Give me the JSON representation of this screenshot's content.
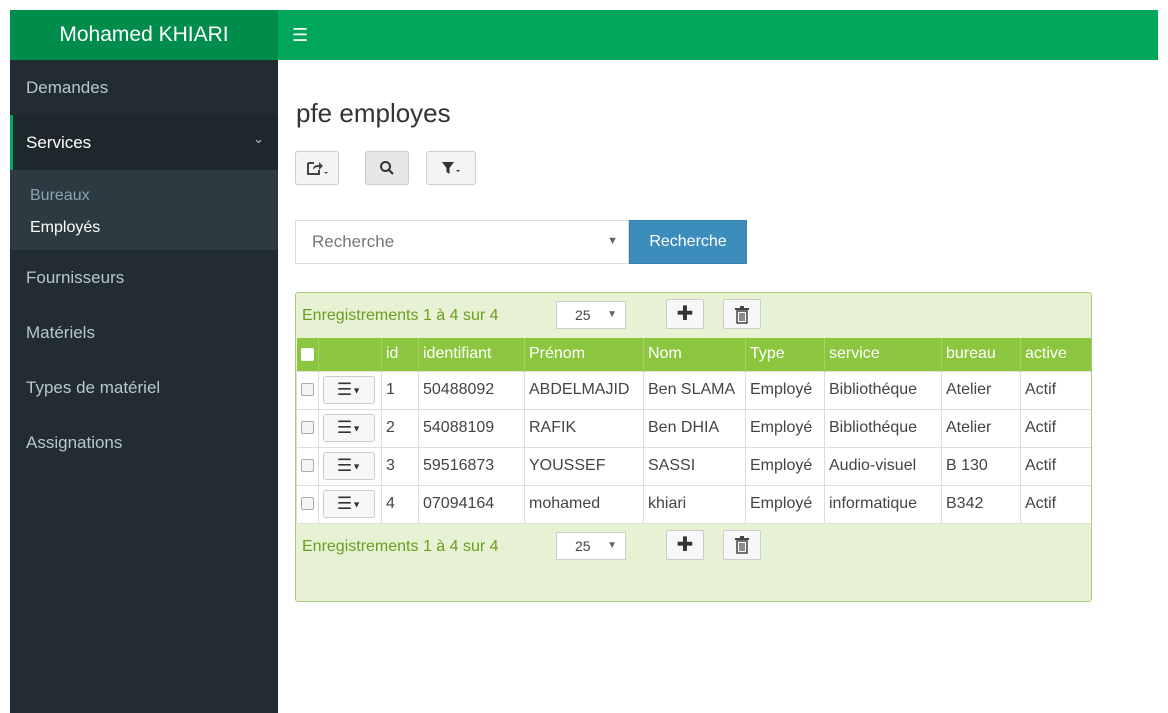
{
  "app": {
    "brand": "Mohamed KHIARI",
    "menu_icon": "hamburger-icon"
  },
  "sidebar": {
    "items_before": [
      {
        "label": "Demandes"
      }
    ],
    "services": {
      "label": "Services"
    },
    "submenu": [
      {
        "label": "Bureaux"
      },
      {
        "label": "Employés"
      }
    ],
    "items_after": [
      {
        "label": "Fournisseurs"
      },
      {
        "label": "Matériels"
      },
      {
        "label": "Types de matériel"
      },
      {
        "label": "Assignations"
      }
    ]
  },
  "page": {
    "title": "pfe employes"
  },
  "toolbar": {
    "export_icon": "export-icon",
    "search_icon": "search-icon",
    "filter_icon": "filter-icon"
  },
  "search": {
    "placeholder": "Recherche",
    "button_label": "Recherche"
  },
  "grid": {
    "records_info": "Enregistrements 1 à 4 sur 4",
    "page_size": "25",
    "columns": [
      "id",
      "identifiant",
      "Prénom",
      "Nom",
      "Type",
      "service",
      "bureau",
      "active"
    ],
    "rows": [
      [
        "1",
        "50488092",
        "ABDELMAJID",
        "Ben SLAMA",
        "Employé",
        "Bibliothéque",
        "Atelier",
        "Actif"
      ],
      [
        "2",
        "54088109",
        "RAFIK",
        "Ben DHIA",
        "Employé",
        "Bibliothéque",
        "Atelier",
        "Actif"
      ],
      [
        "3",
        "59516873",
        "YOUSSEF",
        "SASSI",
        "Employé",
        "Audio-visuel",
        "B 130",
        "Actif"
      ],
      [
        "4",
        "07094164",
        "mohamed",
        "khiari",
        "Employé",
        "informatique",
        "B342",
        "Actif"
      ]
    ]
  },
  "colors": {
    "header_green": "#00a65a",
    "brand_green": "#008d4c",
    "sidebar": "#222d32",
    "table_header": "#8cc63f",
    "grid_bg": "#e6f2d3",
    "primary_button": "#3c8dbc"
  }
}
